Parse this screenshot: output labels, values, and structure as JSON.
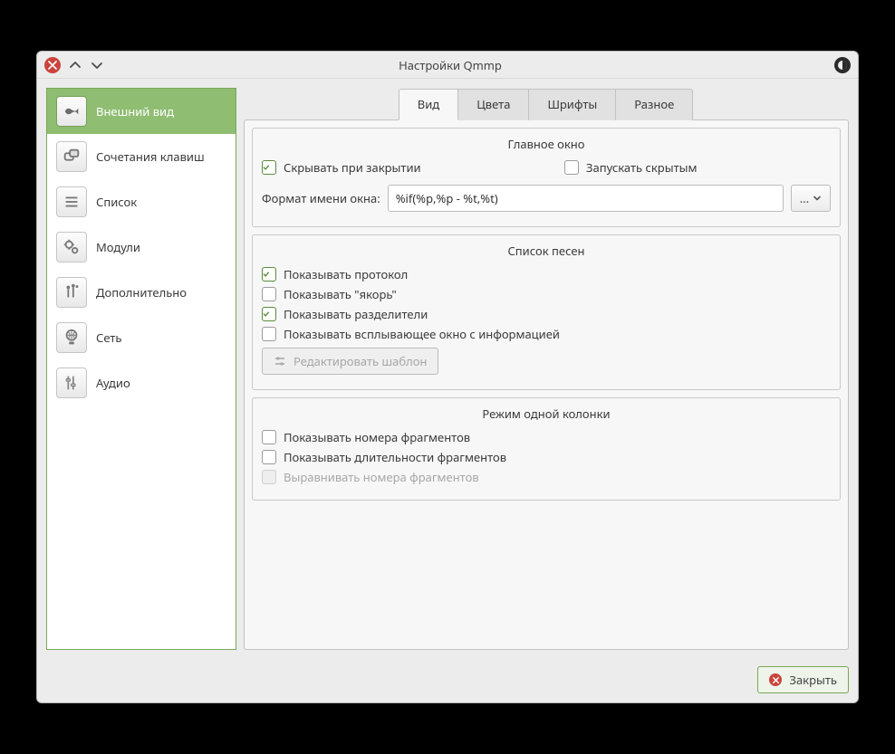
{
  "window": {
    "title": "Настройки Qmmp"
  },
  "sidebar": {
    "items": [
      {
        "label": "Внешний вид"
      },
      {
        "label": "Сочетания клавиш"
      },
      {
        "label": "Список"
      },
      {
        "label": "Модули"
      },
      {
        "label": "Дополнительно"
      },
      {
        "label": "Сеть"
      },
      {
        "label": "Аудио"
      }
    ]
  },
  "tabs": {
    "items": [
      {
        "label": "Вид"
      },
      {
        "label": "Цвета"
      },
      {
        "label": "Шрифты"
      },
      {
        "label": "Разное"
      }
    ],
    "active": 0
  },
  "group_main": {
    "title": "Главное окно",
    "hide_on_close": {
      "label": "Скрывать при закрытии",
      "checked": true
    },
    "start_hidden": {
      "label": "Запускать скрытым",
      "checked": false
    },
    "format_label": "Формат имени окна:",
    "format_value": "%if(%p,%p - %t,%t)",
    "menu_button": "..."
  },
  "group_songs": {
    "title": "Список песен",
    "show_protocol": {
      "label": "Показывать протокол",
      "checked": true
    },
    "show_anchor": {
      "label": "Показывать \"якорь\"",
      "checked": false
    },
    "show_dividers": {
      "label": "Показывать разделители",
      "checked": true
    },
    "show_popup": {
      "label": "Показывать всплывающее окно с информацией",
      "checked": false
    },
    "edit_template_btn": "Редактировать шаблон"
  },
  "group_single": {
    "title": "Режим одной колонки",
    "show_numbers": {
      "label": "Показывать номера фрагментов",
      "checked": false
    },
    "show_durations": {
      "label": "Показывать длительности фрагментов",
      "checked": false
    },
    "align_numbers": {
      "label": "Выравнивать номера фрагментов",
      "checked": false,
      "disabled": true
    }
  },
  "footer": {
    "close": "Закрыть"
  }
}
